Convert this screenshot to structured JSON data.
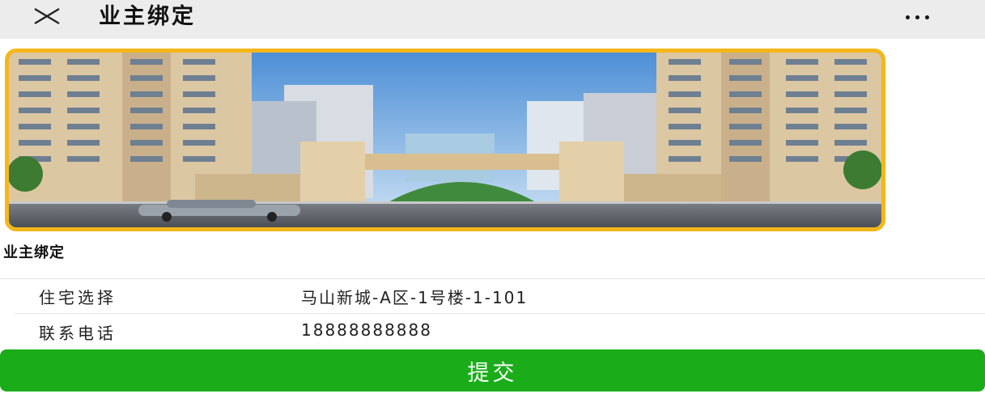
{
  "header": {
    "title": "业主绑定"
  },
  "section": {
    "title": "业主绑定"
  },
  "form": {
    "residence_label": "住宅选择",
    "residence_value": "马山新城-A区-1号楼-1-101",
    "phone_label": "联系电话",
    "phone_value": "18888888888"
  },
  "submit_label": "提交",
  "colors": {
    "accent_green": "#1aad19",
    "banner_border": "#f4b71a"
  }
}
